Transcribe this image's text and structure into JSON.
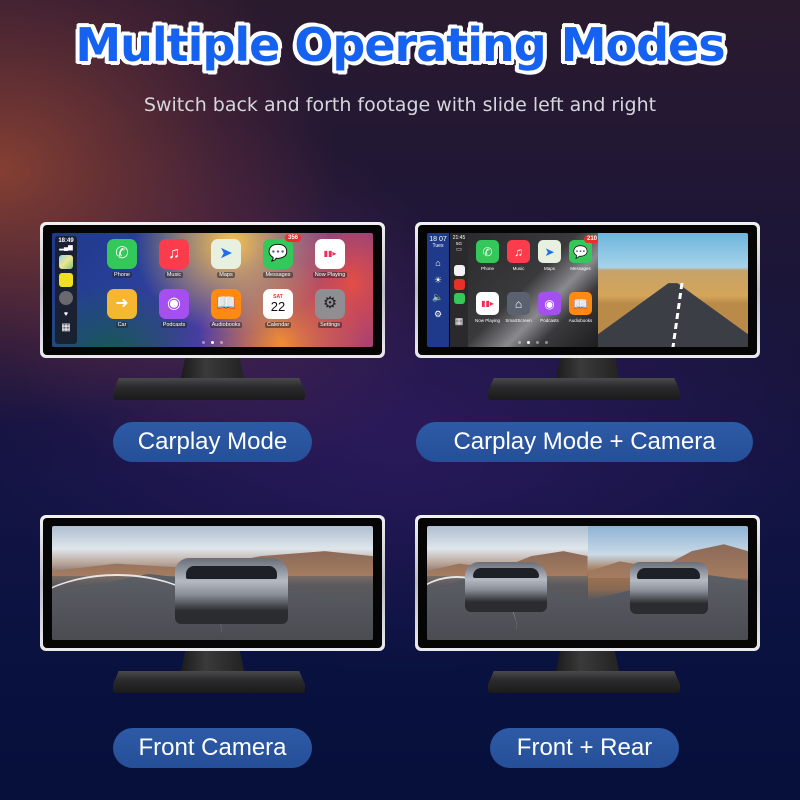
{
  "header": {
    "title": "Multiple Operating Modes",
    "subtitle": "Switch back and forth footage with slide left and right"
  },
  "colors": {
    "title_fill": "#1662f0",
    "title_outline": "#ffffff",
    "pill_bg": "#2a55a0",
    "accent_sidebar": "#1f3a8a"
  },
  "modes": [
    {
      "label": "Carplay Mode",
      "screen": {
        "status_time": "18:49",
        "apps": [
          {
            "label": "Phone",
            "icon": "phone-icon",
            "color": "#34c759"
          },
          {
            "label": "Music",
            "icon": "music-icon",
            "color": "#fa3c4c"
          },
          {
            "label": "Maps",
            "icon": "maps-icon",
            "color": "#e8f0e0"
          },
          {
            "label": "Messages",
            "icon": "messages-icon",
            "color": "#34c759",
            "badge": "356"
          },
          {
            "label": "Now Playing",
            "icon": "now-playing-icon",
            "color": "#ffffff"
          },
          {
            "label": "Car",
            "icon": "car-icon",
            "color": "#f5b731"
          },
          {
            "label": "Podcasts",
            "icon": "podcasts-icon",
            "color": "#a64ff0"
          },
          {
            "label": "Audiobooks",
            "icon": "audiobooks-icon",
            "color": "#ff8a12"
          },
          {
            "label": "Calendar",
            "icon": "calendar-icon",
            "color": "#ffffff",
            "day": "SAT",
            "date": "22"
          },
          {
            "label": "Settings",
            "icon": "settings-icon",
            "color": "#8e8e93"
          }
        ],
        "page_count": 3,
        "active_page": 2
      }
    },
    {
      "label": "Carplay Mode + Camera",
      "screen": {
        "side_time": "18 07",
        "side_day": "Tues",
        "strip_time": "21:45",
        "strip_signal": "5G",
        "apps": [
          {
            "label": "Phone",
            "icon": "phone-icon",
            "color": "#34c759"
          },
          {
            "label": "Music",
            "icon": "music-icon",
            "color": "#fa3c4c"
          },
          {
            "label": "Maps",
            "icon": "maps-icon",
            "color": "#e8f0e0"
          },
          {
            "label": "Messages",
            "icon": "messages-icon",
            "color": "#34c759",
            "badge": "210"
          },
          {
            "label": "Now Playing",
            "icon": "now-playing-icon",
            "color": "#ffffff"
          },
          {
            "label": "SmartScreen",
            "icon": "home-icon",
            "color": "#5a6270"
          },
          {
            "label": "Podcasts",
            "icon": "podcasts-icon",
            "color": "#a64ff0"
          },
          {
            "label": "Audiobooks",
            "icon": "audiobooks-icon",
            "color": "#ff8a12"
          }
        ],
        "page_count": 4,
        "active_page": 2
      }
    },
    {
      "label": "Front Camera"
    },
    {
      "label": "Front + Rear"
    }
  ]
}
